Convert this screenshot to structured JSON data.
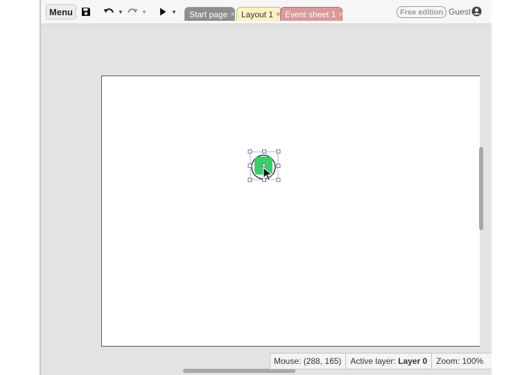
{
  "toolbar": {
    "menu_label": "Menu",
    "icons": [
      "save-icon",
      "undo-icon",
      "redo-icon",
      "play-icon"
    ]
  },
  "tabs": [
    {
      "label": "Start page",
      "close": "×",
      "color": "#8e8e8e"
    },
    {
      "label": "Layout 1",
      "close": "×",
      "color": "#fbf1c7"
    },
    {
      "label": "Event sheet 1",
      "close": "×",
      "color": "#d99a9a"
    }
  ],
  "account": {
    "badge": "Free edition",
    "user": "Guest",
    "icon": "user-circle-icon"
  },
  "canvas": {
    "object_color": "#3dcc6a",
    "object_icon": "sprite-object"
  },
  "status": {
    "mouse_label": "Mouse:",
    "mouse_value": "(288, 165)",
    "layer_label": "Active layer:",
    "layer_value": "Layer 0",
    "zoom_label": "Zoom:",
    "zoom_value": "100%"
  }
}
